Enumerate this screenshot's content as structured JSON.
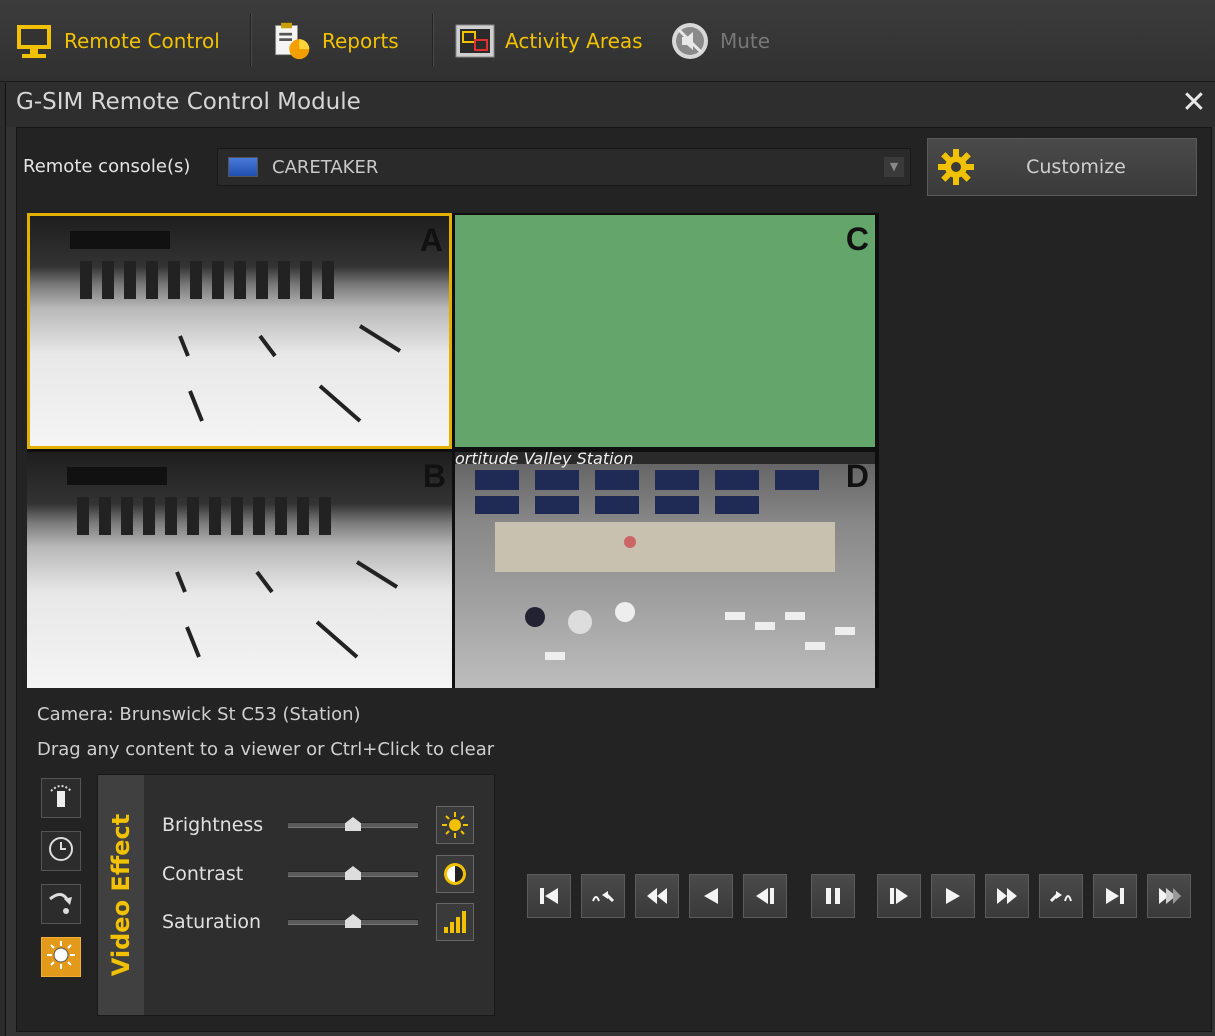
{
  "toolbar": {
    "items": [
      {
        "label": "Remote Control",
        "icon": "monitor-icon",
        "enabled": true
      },
      {
        "label": "Reports",
        "icon": "clipboard-chart-icon",
        "enabled": true
      },
      {
        "label": "Activity Areas",
        "icon": "activity-areas-icon",
        "enabled": true
      },
      {
        "label": "Mute",
        "icon": "speaker-mute-icon",
        "enabled": false
      }
    ]
  },
  "module": {
    "title": "G-SIM Remote Control Module",
    "close_label": "✕"
  },
  "console": {
    "label": "Remote console(s)",
    "value": "CARETAKER",
    "customize_label": "Customize"
  },
  "viewers": [
    {
      "letter": "A",
      "selected": true
    },
    {
      "letter": "B",
      "selected": false
    },
    {
      "letter": "C",
      "selected": false
    },
    {
      "letter": "D",
      "selected": false,
      "overlay_text": "ortitude Valley Station"
    }
  ],
  "camera_info": "Camera: Brunswick St C53 (Station)",
  "hint": "Drag any content to a viewer or Ctrl+Click to clear",
  "video_effect": {
    "title": "Video Effect",
    "sliders": [
      {
        "label": "Brightness",
        "value": 0.5,
        "icon": "brightness-icon"
      },
      {
        "label": "Contrast",
        "value": 0.5,
        "icon": "contrast-icon"
      },
      {
        "label": "Saturation",
        "value": 0.5,
        "icon": "saturation-icon"
      }
    ]
  },
  "colors": {
    "accent": "#f2c200",
    "selected_border": "#e2b000",
    "viewer_c_bg": "#63a56a"
  }
}
